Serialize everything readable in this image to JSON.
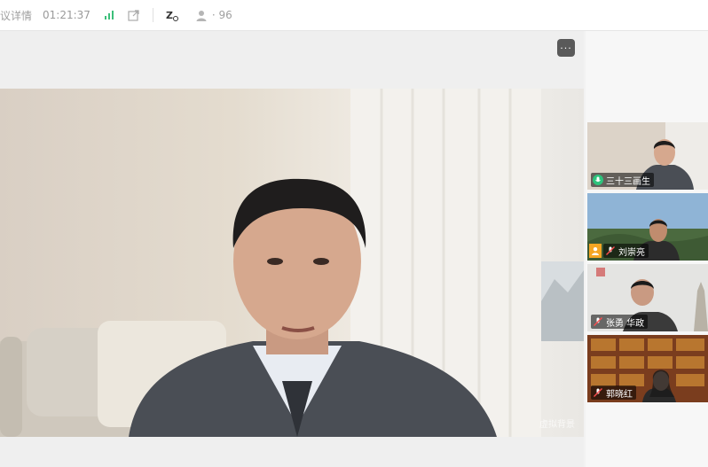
{
  "topbar": {
    "meeting_info_label": "议详情",
    "timer": "01:21:37",
    "participants_count": "· 96",
    "signal_color": "#3cbf7a"
  },
  "main": {
    "more_label": "···",
    "watermark": "虚拟背景"
  },
  "sidebar": {
    "tiles": [
      {
        "name": "三十三画生",
        "active": true
      },
      {
        "name": "刘崇亮",
        "host": true
      },
      {
        "name": "张勇 华政"
      },
      {
        "name": "郭晓红"
      }
    ]
  }
}
